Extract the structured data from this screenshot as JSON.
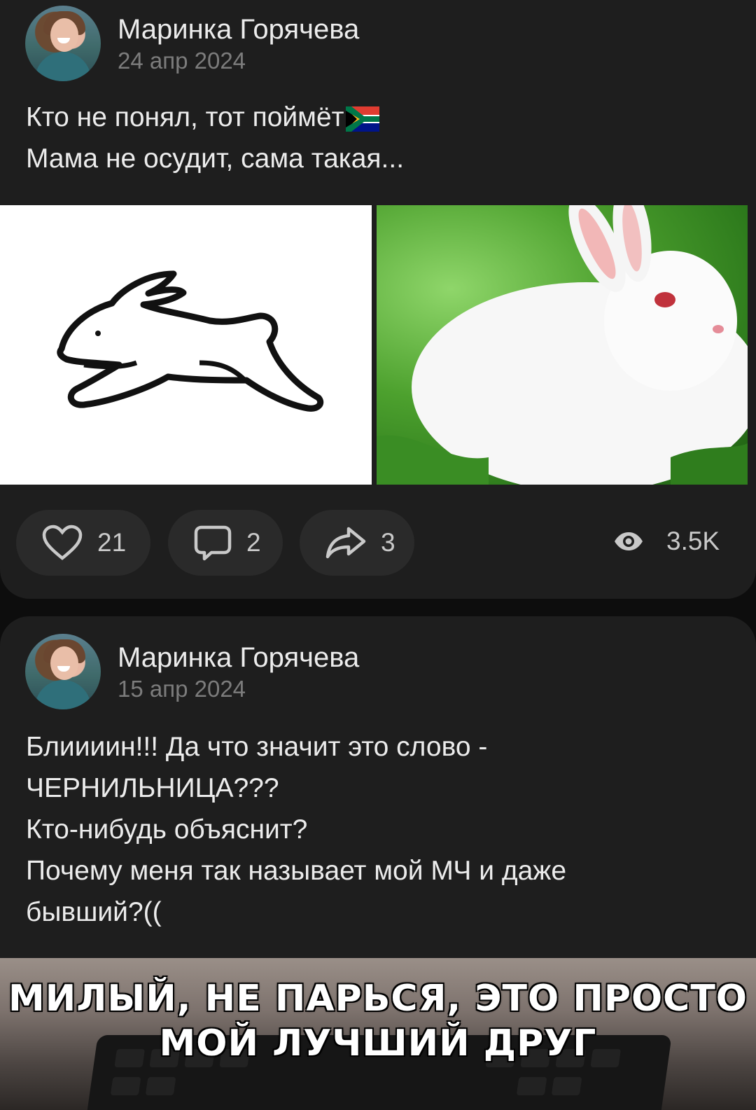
{
  "posts": [
    {
      "author": "Маринка Горячева",
      "date": "24 апр 2024",
      "text_lines": [
        "Кто не понял, тот поймёт",
        "Мама не осудит, сама такая..."
      ],
      "stats": {
        "likes": "21",
        "comments": "2",
        "shares": "3",
        "views": "3.5K"
      }
    },
    {
      "author": "Маринка Горячева",
      "date": "15 апр 2024",
      "text_lines": [
        "Блиииин!!! Да что значит это слово -",
        "ЧЕРНИЛЬНИЦА???",
        "Кто-нибудь объяснит?",
        "Почему меня так называет мой МЧ и даже",
        "бывший?(("
      ],
      "meme_caption": [
        "МИЛЫЙ, НЕ ПАРЬСЯ, ЭТО ПРОСТО",
        "МОЙ ЛУЧШИЙ ДРУГ"
      ]
    }
  ],
  "icons": {
    "like": "heart-icon",
    "comment": "comment-icon",
    "share": "share-icon",
    "views": "eye-icon",
    "flag": "south-africa-flag-icon"
  },
  "colors": {
    "background": "#0d0d0d",
    "card": "#1e1e1e",
    "pill": "#2a2a2a",
    "text": "#ececec",
    "muted": "#7c7c7c"
  }
}
